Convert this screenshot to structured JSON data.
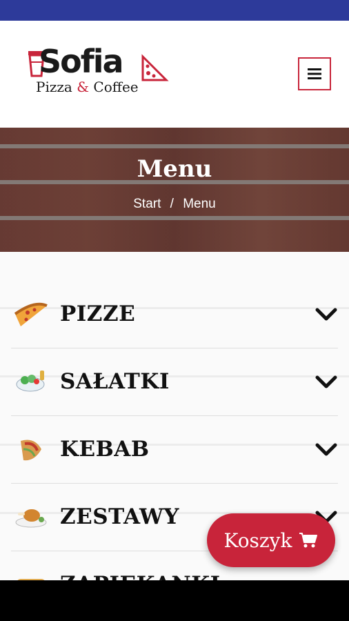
{
  "header": {
    "logo_word": "Sofia",
    "logo_sub_a": "Pizza",
    "logo_sub_amp": "&",
    "logo_sub_b": "Coffee"
  },
  "hero": {
    "title": "Menu",
    "breadcrumb": {
      "start": "Start",
      "sep": "/",
      "current": "Menu"
    }
  },
  "categories": [
    {
      "label": "PIZZE",
      "icon": "pizza-slice-icon"
    },
    {
      "label": "SAŁATKI",
      "icon": "salad-bowl-icon"
    },
    {
      "label": "KEBAB",
      "icon": "kebab-wrap-icon"
    },
    {
      "label": "ZESTAWY",
      "icon": "chicken-plate-icon"
    },
    {
      "label": "ZAPIEKANKI",
      "icon": "zapiekanka-icon"
    }
  ],
  "cart": {
    "label": "Koszyk",
    "icon": "shopping-cart-icon"
  },
  "colors": {
    "accent": "#c8243a",
    "statusbar": "#2d3a9a"
  }
}
